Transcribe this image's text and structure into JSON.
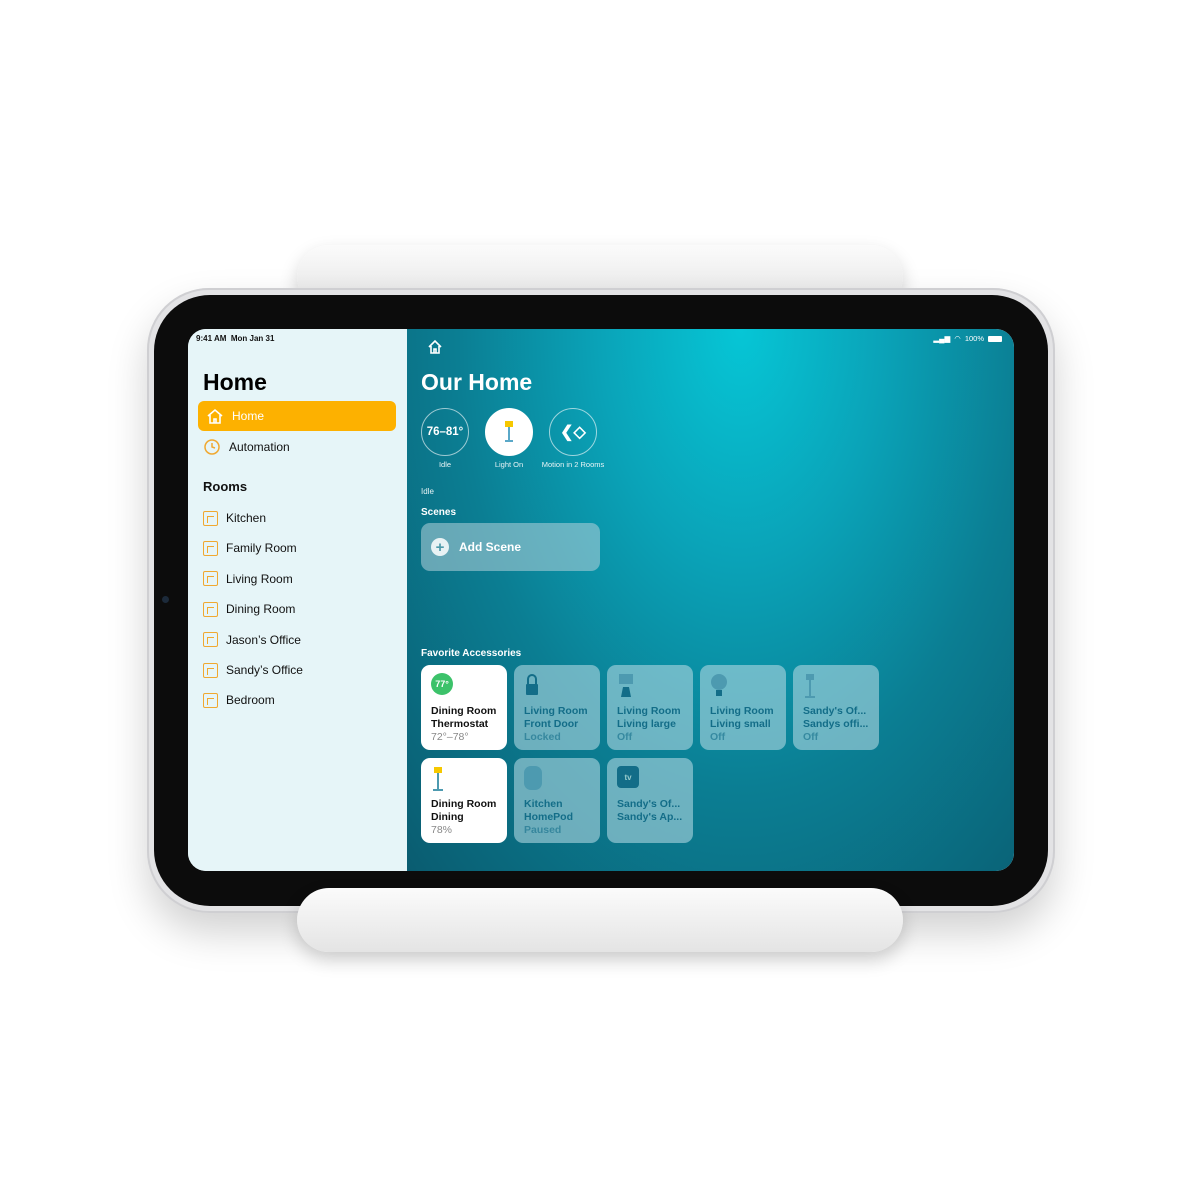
{
  "status": {
    "time": "9:41 AM",
    "date": "Mon Jan 31",
    "battery": "100%"
  },
  "sidebar": {
    "title": "Home",
    "nav": [
      {
        "label": "Home",
        "icon": "house-icon",
        "selected": true
      },
      {
        "label": "Automation",
        "icon": "clock-icon"
      }
    ],
    "rooms_header": "Rooms",
    "rooms": [
      "Kitchen",
      "Family Room",
      "Living Room",
      "Dining Room",
      "Jason’s Office",
      "Sandy’s Office",
      "Bedroom"
    ]
  },
  "main": {
    "title": "Our Home",
    "status_items": [
      {
        "value": "76–81°",
        "label": "Idle"
      },
      {
        "label": "Light On"
      },
      {
        "label": "Motion in 2 Rooms"
      }
    ],
    "status_sub": "Idle",
    "scenes_header": "Scenes",
    "add_scene": "Add Scene",
    "favorites_header": "Favorite Accessories",
    "tiles": [
      {
        "line1": "Dining Room",
        "line2": "Thermostat",
        "status": "72°–78°",
        "badge": "77°",
        "on": true,
        "icon": "thermostat-icon"
      },
      {
        "line1": "Living Room",
        "line2": "Front Door",
        "status": "Locked",
        "icon": "lock-icon"
      },
      {
        "line1": "Living Room",
        "line2": "Living large",
        "status": "Off",
        "icon": "lamp-icon"
      },
      {
        "line1": "Living Room",
        "line2": "Living small",
        "status": "Off",
        "icon": "bulb-icon"
      },
      {
        "line1": "Sandy's Of...",
        "line2": "Sandys offi...",
        "status": "Off",
        "icon": "floor-lamp-icon"
      },
      {
        "line1": "Dining Room",
        "line2": "Dining",
        "status": "78%",
        "on": true,
        "icon": "floor-lamp-icon"
      },
      {
        "line1": "Kitchen",
        "line2": "HomePod",
        "status": "Paused",
        "icon": "homepod-icon"
      },
      {
        "line1": "Sandy's Of...",
        "line2": "Sandy's Ap...",
        "status": "",
        "icon": "apple-tv-icon",
        "badge": "tv"
      }
    ]
  },
  "colors": {
    "accent": "#fdb100",
    "sidebar_bg": "#e6f5f8",
    "thermo_badge": "#3cc26a",
    "tile_text": "#136d88"
  }
}
